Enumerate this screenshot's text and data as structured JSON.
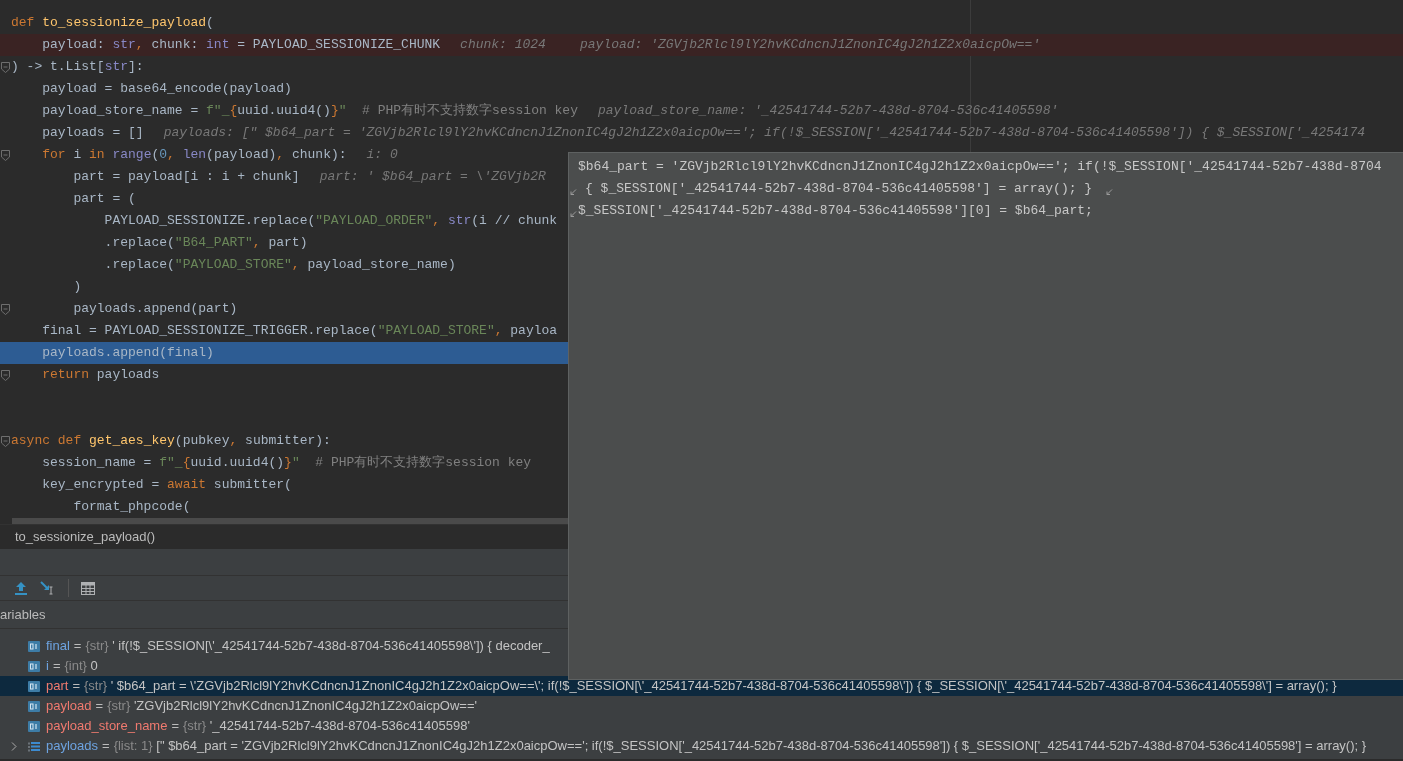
{
  "editor": {
    "lines": [
      {
        "tokens": [
          {
            "text": "def",
            "kind": "keyword"
          },
          {
            "text": " to_sessionize_payload",
            "kind": "function"
          },
          {
            "text": "(",
            "kind": "plain"
          }
        ]
      },
      {
        "breakpoint": true,
        "tokens": [
          {
            "text": "    payload: ",
            "kind": "plain"
          },
          {
            "text": "str",
            "kind": "builtin"
          },
          {
            "text": ",",
            "kind": "comma"
          },
          {
            "text": " chunk: ",
            "kind": "plain"
          },
          {
            "text": "int",
            "kind": "builtin"
          },
          {
            "text": " = PAYLOAD_SESSIONIZE_CHUNK",
            "kind": "plain"
          }
        ],
        "hints": [
          "chunk: 1024",
          "payload: 'ZGVjb2Rlcl9lY2hvKCdncnJ1ZnonIC4gJ2h1Z2x0aicpOw=='"
        ]
      },
      {
        "fold": true,
        "tokens": [
          {
            "text": ") -> t.List[",
            "kind": "plain"
          },
          {
            "text": "str",
            "kind": "builtin"
          },
          {
            "text": "]:",
            "kind": "plain"
          }
        ]
      },
      {
        "tokens": [
          {
            "text": "    payload = base64_encode(payload)",
            "kind": "plain"
          }
        ]
      },
      {
        "tokens": [
          {
            "text": "    payload_store_name = ",
            "kind": "plain"
          },
          {
            "text": "f\"_",
            "kind": "string"
          },
          {
            "text": "{",
            "kind": "comma"
          },
          {
            "text": "uuid.uuid4()",
            "kind": "plain"
          },
          {
            "text": "}",
            "kind": "comma"
          },
          {
            "text": "\"",
            "kind": "string"
          },
          {
            "text": "  # PHP有时不支持数字session key",
            "kind": "comment"
          }
        ],
        "hints": [
          "payload_store_name: '_42541744-52b7-438d-8704-536c41405598'"
        ]
      },
      {
        "tokens": [
          {
            "text": "    payloads = []",
            "kind": "plain"
          }
        ],
        "hints": [
          "payloads: [\" $b64_part = 'ZGVjb2Rlcl9lY2hvKCdncnJ1ZnonIC4gJ2h1Z2x0aicpOw=='; if(!$_SESSION['_42541744-52b7-438d-8704-536c41405598']) { $_SESSION['_4254174"
        ]
      },
      {
        "fold": true,
        "tokens": [
          {
            "text": "    for",
            "kind": "keyword"
          },
          {
            "text": " i ",
            "kind": "plain"
          },
          {
            "text": "in",
            "kind": "keyword"
          },
          {
            "text": " range",
            "kind": "builtin"
          },
          {
            "text": "(",
            "kind": "plain"
          },
          {
            "text": "0",
            "kind": "number"
          },
          {
            "text": ",",
            "kind": "comma"
          },
          {
            "text": " len",
            "kind": "builtin"
          },
          {
            "text": "(payload)",
            "kind": "plain"
          },
          {
            "text": ",",
            "kind": "comma"
          },
          {
            "text": " chunk):",
            "kind": "plain"
          }
        ],
        "hints": [
          "i: 0"
        ]
      },
      {
        "tokens": [
          {
            "text": "        part = payload[i : i + chunk]",
            "kind": "plain"
          }
        ],
        "hints": [
          "part: ' $b64_part = \\'ZGVjb2R"
        ]
      },
      {
        "tokens": [
          {
            "text": "        part = (",
            "kind": "plain"
          }
        ]
      },
      {
        "tokens": [
          {
            "text": "            PAYLOAD_SESSIONIZE.replace(",
            "kind": "plain"
          },
          {
            "text": "\"PAYLOAD_ORDER\"",
            "kind": "string"
          },
          {
            "text": ",",
            "kind": "comma"
          },
          {
            "text": " str",
            "kind": "builtin"
          },
          {
            "text": "(i // chunk",
            "kind": "plain"
          }
        ]
      },
      {
        "tokens": [
          {
            "text": "            .replace(",
            "kind": "plain"
          },
          {
            "text": "\"B64_PART\"",
            "kind": "string"
          },
          {
            "text": ",",
            "kind": "comma"
          },
          {
            "text": " part)",
            "kind": "plain"
          }
        ]
      },
      {
        "tokens": [
          {
            "text": "            .replace(",
            "kind": "plain"
          },
          {
            "text": "\"PAYLOAD_STORE\"",
            "kind": "string"
          },
          {
            "text": ",",
            "kind": "comma"
          },
          {
            "text": " payload_store_name)",
            "kind": "plain"
          }
        ]
      },
      {
        "tokens": [
          {
            "text": "        )",
            "kind": "plain"
          }
        ]
      },
      {
        "fold": true,
        "tokens": [
          {
            "text": "        payloads.append(part)",
            "kind": "plain"
          }
        ]
      },
      {
        "tokens": [
          {
            "text": "    final = PAYLOAD_SESSIONIZE_TRIGGER.replace(",
            "kind": "plain"
          },
          {
            "text": "\"PAYLOAD_STORE\"",
            "kind": "string"
          },
          {
            "text": ",",
            "kind": "comma"
          },
          {
            "text": " payloa",
            "kind": "plain"
          }
        ]
      },
      {
        "execution_point": true,
        "tokens": [
          {
            "text": "    payloads.append(final)",
            "kind": "plain"
          }
        ]
      },
      {
        "fold": true,
        "tokens": [
          {
            "text": "    return",
            "kind": "keyword"
          },
          {
            "text": " payloads",
            "kind": "plain"
          }
        ]
      },
      {
        "blank": true
      },
      {
        "blank": true
      },
      {
        "fold": true,
        "tokens": [
          {
            "text": "async",
            "kind": "keyword"
          },
          {
            "text": " def",
            "kind": "keyword"
          },
          {
            "text": " get_aes_key",
            "kind": "function"
          },
          {
            "text": "(pubkey",
            "kind": "plain"
          },
          {
            "text": ",",
            "kind": "comma"
          },
          {
            "text": " submitter):",
            "kind": "plain"
          }
        ]
      },
      {
        "tokens": [
          {
            "text": "    session_name = ",
            "kind": "plain"
          },
          {
            "text": "f\"_",
            "kind": "string"
          },
          {
            "text": "{",
            "kind": "comma"
          },
          {
            "text": "uuid.uuid4()",
            "kind": "plain"
          },
          {
            "text": "}",
            "kind": "comma"
          },
          {
            "text": "\"",
            "kind": "string"
          },
          {
            "text": "  # PHP有时不支持数字session key",
            "kind": "comment"
          }
        ]
      },
      {
        "tokens": [
          {
            "text": "    key_encrypted = ",
            "kind": "plain"
          },
          {
            "text": "await",
            "kind": "keyword"
          },
          {
            "text": " submitter(",
            "kind": "plain"
          }
        ]
      },
      {
        "tokens": [
          {
            "text": "        format_phpcode(",
            "kind": "plain"
          }
        ]
      }
    ]
  },
  "tooltip": {
    "lines": [
      {
        "text": "$b64_part = 'ZGVjb2Rlcl9lY2hvKCdncnJ1ZnonIC4gJ2h1Z2x0aicpOw=='; if(!$_SESSION['_42541744-52b7-438d-8704",
        "wrap_before": false,
        "wrap_after": false
      },
      {
        "text": "{ $_SESSION['_42541744-52b7-438d-8704-536c41405598'] = array(); }",
        "wrap_before": true,
        "wrap_after": true
      },
      {
        "text": "$_SESSION['_42541744-52b7-438d-8704-536c41405598'][0] = $b64_part;",
        "wrap_before": true,
        "wrap_after": false
      }
    ]
  },
  "breadcrumb": "to_sessionize_payload()",
  "variables": {
    "header": "ariables",
    "rows": [
      {
        "kind": "scalar",
        "name": "final",
        "sign": "=",
        "type": "{str}",
        "value": "' if(!$_SESSION[\\'_42541744-52b7-438d-8704-536c41405598\\']) { decoder_",
        "changed": false,
        "selected": false
      },
      {
        "kind": "scalar",
        "name": "i",
        "sign": "=",
        "type": "{int}",
        "value": "0",
        "changed": false,
        "selected": false
      },
      {
        "kind": "scalar",
        "name": "part",
        "sign": "=",
        "type": "{str}",
        "value": "' $b64_part = \\'ZGVjb2Rlcl9lY2hvKCdncnJ1ZnonIC4gJ2h1Z2x0aicpOw==\\'; if(!$_SESSION[\\'_42541744-52b7-438d-8704-536c41405598\\']) { $_SESSION[\\'_42541744-52b7-438d-8704-536c41405598\\'] = array(); }",
        "changed": true,
        "selected": true
      },
      {
        "kind": "scalar",
        "name": "payload",
        "sign": "=",
        "type": "{str}",
        "value": "'ZGVjb2Rlcl9lY2hvKCdncnJ1ZnonIC4gJ2h1Z2x0aicpOw=='",
        "changed": true,
        "selected": false
      },
      {
        "kind": "scalar",
        "name": "payload_store_name",
        "sign": "=",
        "type": "{str}",
        "value": "'_42541744-52b7-438d-8704-536c41405598'",
        "changed": true,
        "selected": false
      },
      {
        "kind": "list",
        "name": "payloads",
        "sign": "=",
        "type": "{list: 1}",
        "value": "[\" $b64_part = 'ZGVjb2Rlcl9lY2hvKCdncnJ1ZnonIC4gJ2h1Z2x0aicpOw=='; if(!$_SESSION['_42541744-52b7-438d-8704-536c41405598']) { $_SESSION['_42541744-52b7-438d-8704-536c41405598'] = array(); }",
        "changed": false,
        "selected": false
      }
    ]
  }
}
